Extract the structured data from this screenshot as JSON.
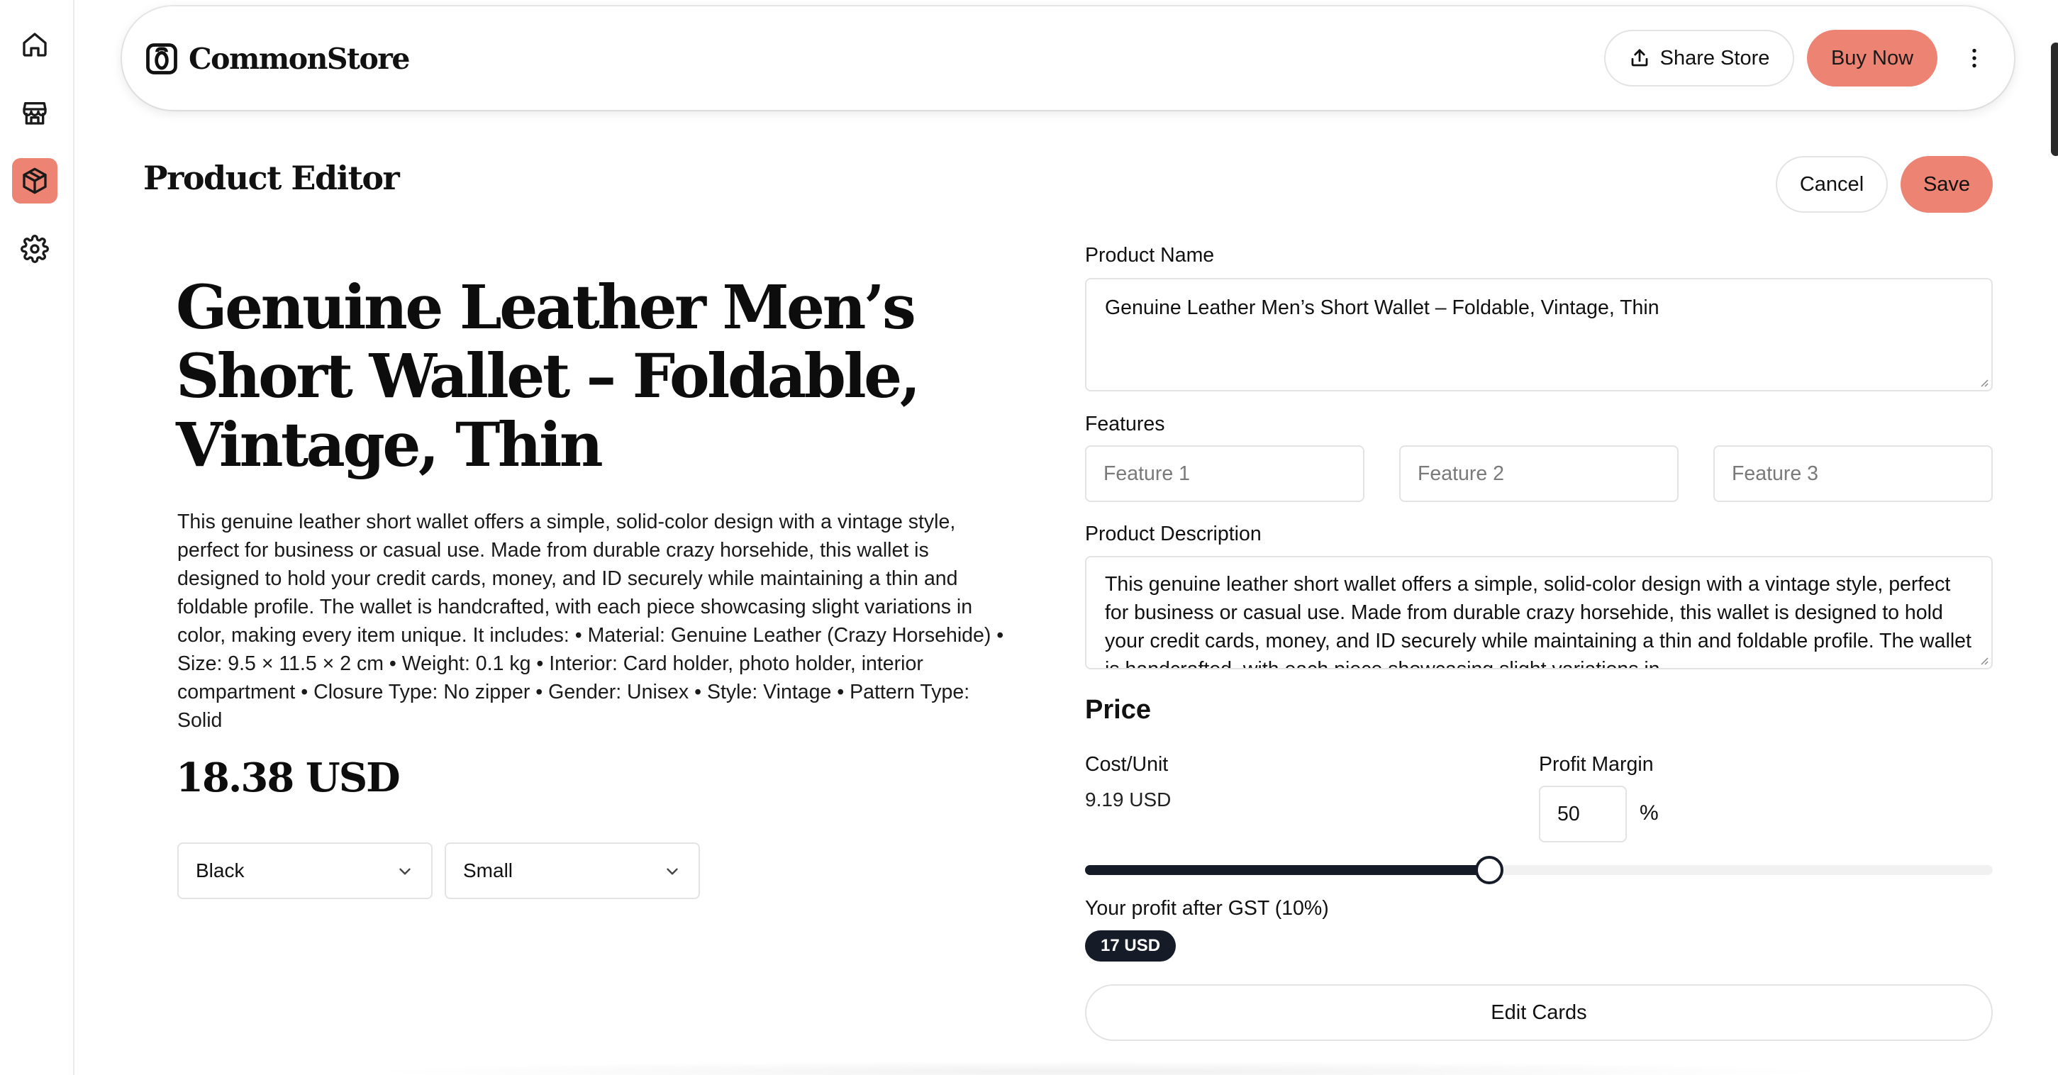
{
  "sidebar": {
    "items": [
      {
        "icon": "home-icon",
        "active": false
      },
      {
        "icon": "store-icon",
        "active": false
      },
      {
        "icon": "package-icon",
        "active": true
      },
      {
        "icon": "settings-icon",
        "active": false
      }
    ]
  },
  "header": {
    "brand": "CommonStore",
    "share_label": "Share Store",
    "buy_label": "Buy Now"
  },
  "page": {
    "title": "Product Editor",
    "cancel_label": "Cancel",
    "save_label": "Save"
  },
  "preview": {
    "title": "Genuine Leather Men’s Short Wallet – Foldable, Vintage, Thin",
    "description": "This genuine leather short wallet offers a simple, solid-color design with a vintage style, perfect for business or casual use. Made from durable crazy horsehide, this wallet is designed to hold your credit cards, money, and ID securely while maintaining a thin and foldable profile. The wallet is handcrafted, with each piece showcasing slight variations in color, making every item unique. It includes: • Material: Genuine Leather (Crazy Horsehide) • Size: 9.5 × 11.5 × 2 cm • Weight: 0.1 kg • Interior: Card holder, photo holder, interior compartment • Closure Type: No zipper • Gender: Unisex • Style: Vintage • Pattern Type: Solid",
    "price": "18.38 USD",
    "color_select": "Black",
    "size_select": "Small"
  },
  "form": {
    "product_name_label": "Product Name",
    "product_name_value": "Genuine Leather Men’s Short Wallet – Foldable, Vintage, Thin",
    "features_label": "Features",
    "feature_placeholders": [
      "Feature 1",
      "Feature 2",
      "Feature 3"
    ],
    "description_label": "Product Description",
    "description_value": "This genuine leather short wallet offers a simple, solid-color design with a vintage style, perfect for business or casual use. Made from durable crazy horsehide, this wallet is designed to hold your credit cards, money, and ID securely while maintaining a thin and foldable profile. The wallet is handcrafted, with each piece showcasing slight variations in",
    "price_heading": "Price",
    "cost_label": "Cost/Unit",
    "cost_value": "9.19 USD",
    "margin_label": "Profit Margin",
    "margin_value": "50",
    "margin_unit": "%",
    "slider_value_fraction": 0.445,
    "profit_label": "Your profit after GST (10%)",
    "profit_value": "17 USD",
    "edit_cards_label": "Edit Cards"
  },
  "colors": {
    "accent": "#ec8373",
    "dark": "#161b28",
    "border": "#e3e3e3"
  }
}
